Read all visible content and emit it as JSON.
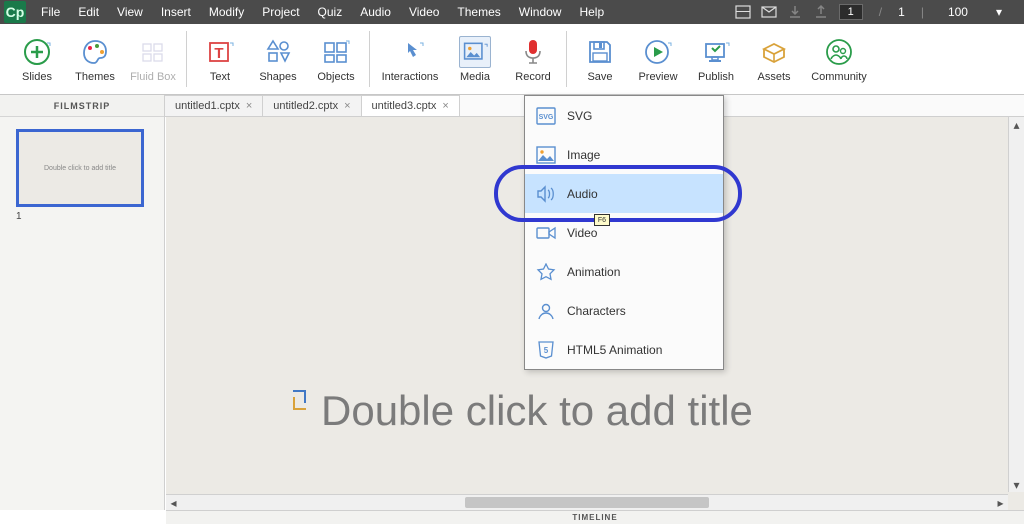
{
  "app": {
    "icon_text": "Cp"
  },
  "menu": [
    "File",
    "Edit",
    "View",
    "Insert",
    "Modify",
    "Project",
    "Quiz",
    "Audio",
    "Video",
    "Themes",
    "Window",
    "Help"
  ],
  "statusbar": {
    "page_current": "1",
    "page_total": "1",
    "zoom": "100"
  },
  "toolbar": {
    "slides": "Slides",
    "themes": "Themes",
    "fluidbox": "Fluid Box",
    "text": "Text",
    "shapes": "Shapes",
    "objects": "Objects",
    "interactions": "Interactions",
    "media": "Media",
    "record": "Record",
    "save": "Save",
    "preview": "Preview",
    "publish": "Publish",
    "assets": "Assets",
    "community": "Community"
  },
  "tabs": [
    "untitled1.cptx",
    "untitled2.cptx",
    "untitled3.cptx"
  ],
  "sidebar": {
    "header": "FILMSTRIP",
    "thumb_text": "Double click to add title",
    "thumb_index": "1"
  },
  "canvas": {
    "title_placeholder": "Double click to add title"
  },
  "timeline": {
    "label": "TIMELINE"
  },
  "dropdown": {
    "items": [
      "SVG",
      "Image",
      "Audio",
      "Video",
      "Animation",
      "Characters",
      "HTML5 Animation"
    ],
    "highlighted": "Audio",
    "tooltip": "F6"
  }
}
